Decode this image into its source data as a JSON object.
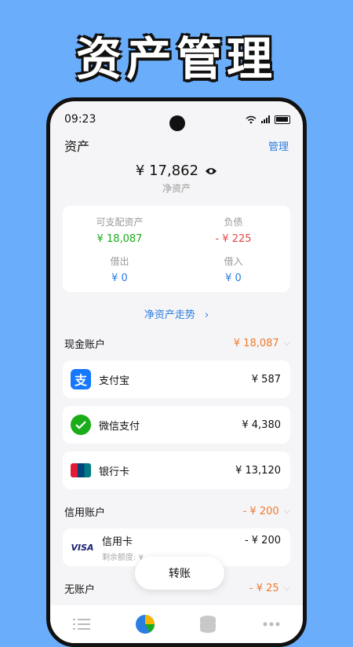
{
  "banner": {
    "title": "资产管理"
  },
  "status": {
    "time": "09:23"
  },
  "header": {
    "title": "资产",
    "manage": "管理"
  },
  "net_assets": {
    "value": "¥ 17,862",
    "label": "净资产"
  },
  "summary": [
    {
      "label": "可支配资产",
      "value": "¥ 18,087",
      "color": "#1aad19"
    },
    {
      "label": "负债",
      "value": "- ¥ 225",
      "color": "#e54545"
    },
    {
      "label": "借出",
      "value": "¥ 0",
      "color": "#2a7de1"
    },
    {
      "label": "借入",
      "value": "¥ 0",
      "color": "#2a7de1"
    }
  ],
  "trend": "净资产走势",
  "sections": {
    "cash": {
      "name": "现金账户",
      "total": "¥ 18,087"
    },
    "credit": {
      "name": "信用账户",
      "total": "- ¥ 200"
    },
    "none": {
      "name": "无账户",
      "total": "- ¥ 25"
    }
  },
  "accounts": {
    "alipay": {
      "name": "支付宝",
      "amount": "¥ 587",
      "icon": "alipay-icon"
    },
    "wechat": {
      "name": "微信支付",
      "amount": "¥ 4,380",
      "icon": "wechat-pay-icon"
    },
    "bank": {
      "name": "银行卡",
      "amount": "¥ 13,120",
      "icon": "unionpay-icon"
    },
    "credit_card": {
      "name": "信用卡",
      "amount": "- ¥ 200",
      "sub": "剩余额度: ¥",
      "icon": "visa-icon"
    }
  },
  "fab": {
    "label": "转账"
  },
  "tabs": [
    "list-icon",
    "pie-chart-icon",
    "coins-icon",
    "more-icon"
  ]
}
